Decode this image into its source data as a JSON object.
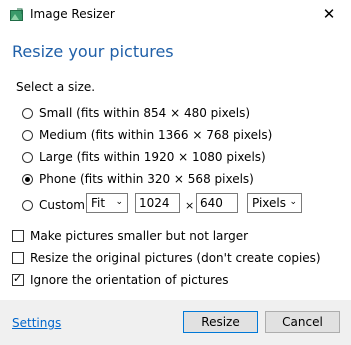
{
  "window": {
    "title": "Image Resizer",
    "close_glyph": "✕"
  },
  "heading": "Resize your pictures",
  "subtitle": "Select a size.",
  "sizes": [
    {
      "label": "Small (fits within 854 × 480 pixels)",
      "checked": false
    },
    {
      "label": "Medium (fits within 1366 × 768 pixels)",
      "checked": false
    },
    {
      "label": "Large (fits within 1920 × 1080 pixels)",
      "checked": false
    },
    {
      "label": "Phone (fits within 320 × 568 pixels)",
      "checked": true
    }
  ],
  "custom": {
    "label": "Custom",
    "mode": "Fit",
    "width": "1024",
    "times": "×",
    "height": "640",
    "unit": "Pixels"
  },
  "options": [
    {
      "label": "Make pictures smaller but not larger",
      "checked": false
    },
    {
      "label": "Resize the original pictures (don't create copies)",
      "checked": false
    },
    {
      "label": "Ignore the orientation of pictures",
      "checked": true
    }
  ],
  "footer": {
    "settings": "Settings",
    "resize": "Resize",
    "cancel": "Cancel"
  },
  "colors": {
    "heading": "#1f5fa8",
    "link": "#0066cc",
    "primary_border": "#0078d7"
  },
  "icons": {
    "app": "image-resizer-icon",
    "close": "close-icon",
    "dropdown": "chevron-down-icon"
  }
}
